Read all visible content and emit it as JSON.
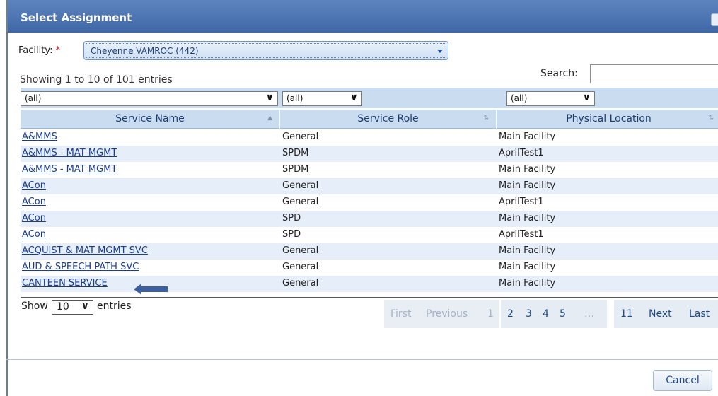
{
  "dialog": {
    "title": "Select Assignment"
  },
  "facility": {
    "label": "Facility:",
    "required_marker": "*",
    "selected": "Cheyenne VAMROC (442)"
  },
  "table_info": {
    "showing": "Showing 1 to 10 of 101 entries",
    "search_label": "Search:",
    "search_value": ""
  },
  "filters": {
    "service_name": "(all)",
    "service_role": "(all)",
    "physical_location": "(all)"
  },
  "columns": [
    {
      "label": "Service Name",
      "sort": "ascending"
    },
    {
      "label": "Service Role",
      "sort": "none"
    },
    {
      "label": "Physical Location",
      "sort": "none"
    }
  ],
  "rows": [
    {
      "service_name": "A&MMS",
      "service_role": "General",
      "physical_location": "Main Facility"
    },
    {
      "service_name": "A&MMS - MAT MGMT",
      "service_role": "SPDM",
      "physical_location": "AprilTest1"
    },
    {
      "service_name": "A&MMS - MAT MGMT",
      "service_role": "SPDM",
      "physical_location": "Main Facility"
    },
    {
      "service_name": "ACon",
      "service_role": "General",
      "physical_location": "Main Facility"
    },
    {
      "service_name": "ACon",
      "service_role": "General",
      "physical_location": "AprilTest1"
    },
    {
      "service_name": "ACon",
      "service_role": "SPD",
      "physical_location": "Main Facility"
    },
    {
      "service_name": "ACon",
      "service_role": "SPD",
      "physical_location": "AprilTest1"
    },
    {
      "service_name": "ACQUIST & MAT MGMT SVC",
      "service_role": "General",
      "physical_location": "Main Facility"
    },
    {
      "service_name": "AUD & SPEECH PATH SVC",
      "service_role": "General",
      "physical_location": "Main Facility"
    },
    {
      "service_name": "CANTEEN SERVICE",
      "service_role": "General",
      "physical_location": "Main Facility"
    }
  ],
  "length": {
    "show": "Show",
    "value": "10",
    "entries": "entries"
  },
  "pagination": {
    "first": "First",
    "previous": "Previous",
    "pages": [
      "1",
      "2",
      "3",
      "4",
      "5",
      "…",
      "11"
    ],
    "current": "1",
    "next": "Next",
    "last": "Last"
  },
  "footer": {
    "cancel": "Cancel"
  },
  "colors": {
    "titlebar": "#4d75b2",
    "header_bg": "#c9dcf0",
    "alt_row": "#e6eef9",
    "link": "#1a3d8f",
    "arrow": "#3d5f9e"
  },
  "icons": {
    "sort_asc": "triangle-up",
    "sort_both": "up-down-arrows",
    "dropdown": "chevron-down",
    "pointer": "left-arrow"
  }
}
